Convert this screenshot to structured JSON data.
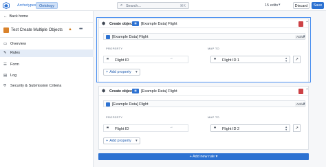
{
  "topbar": {
    "logo": "app-logo",
    "tabs": [
      {
        "label": "Archetypes"
      },
      {
        "label": "Ontology"
      }
    ],
    "search": {
      "placeholder": "Search...",
      "shortcut": "⌘K"
    },
    "edits": "15 edits",
    "discard": "Discard",
    "save": "Save"
  },
  "sidebar": {
    "back": "Back home",
    "object_title": "Test Create Multiple Objects",
    "items": [
      {
        "label": "Overview",
        "icon": "overview-icon"
      },
      {
        "label": "Rules",
        "icon": "rules-icon"
      },
      {
        "label": "Form",
        "icon": "form-icon"
      },
      {
        "label": "Log",
        "icon": "log-icon"
      },
      {
        "label": "Security & Submission Criteria",
        "icon": "security-icon"
      }
    ]
  },
  "rules": [
    {
      "action": "Create object",
      "target": "[Example Data] Flight",
      "object_type": "[Example Data] Flight",
      "status": "Active",
      "property_header": "PROPERTY",
      "map_header": "MAP TO",
      "property": "Flight ID",
      "map_to": "Flight ID 1",
      "add_property": "Add property"
    },
    {
      "action": "Create object",
      "target": "[Example Data] Flight",
      "object_type": "[Example Data] Flight",
      "status": "Active",
      "property_header": "PROPERTY",
      "map_header": "MAP TO",
      "property": "Flight ID",
      "map_to": "Flight ID 2",
      "add_property": "Add property"
    }
  ],
  "add_rule": "Add new rule",
  "colors": {
    "accent": "#2d72d2",
    "danger": "#cd4246",
    "warning": "#c87619",
    "object": "#d9822b"
  }
}
